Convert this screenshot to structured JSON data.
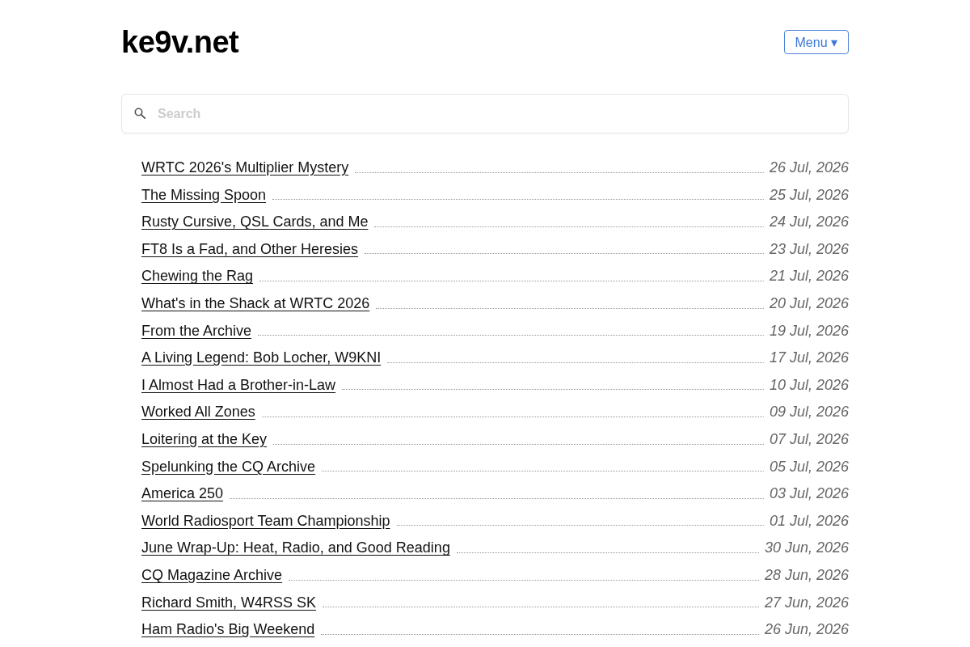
{
  "site": {
    "title": "ke9v.net"
  },
  "menu_button": {
    "label": "Menu ▾"
  },
  "search": {
    "placeholder": "Search"
  },
  "posts": [
    {
      "title": "WRTC 2026's Multiplier Mystery",
      "date": "26 Jul, 2026"
    },
    {
      "title": "The Missing Spoon",
      "date": "25 Jul, 2026"
    },
    {
      "title": "Rusty Cursive, QSL Cards, and Me",
      "date": "24 Jul, 2026"
    },
    {
      "title": "FT8 Is a Fad, and Other Heresies",
      "date": "23 Jul, 2026"
    },
    {
      "title": "Chewing the Rag",
      "date": "21 Jul, 2026"
    },
    {
      "title": "What's in the Shack at WRTC 2026",
      "date": "20 Jul, 2026"
    },
    {
      "title": "From the Archive",
      "date": "19 Jul, 2026"
    },
    {
      "title": "A Living Legend: Bob Locher, W9KNI",
      "date": "17 Jul, 2026"
    },
    {
      "title": "I Almost Had a Brother-in-Law",
      "date": "10 Jul, 2026"
    },
    {
      "title": "Worked All Zones",
      "date": "09 Jul, 2026"
    },
    {
      "title": "Loitering at the Key",
      "date": "07 Jul, 2026"
    },
    {
      "title": "Spelunking the CQ Archive",
      "date": "05 Jul, 2026"
    },
    {
      "title": "America 250",
      "date": "03 Jul, 2026"
    },
    {
      "title": "World Radiosport Team Championship",
      "date": "01 Jul, 2026"
    },
    {
      "title": "June Wrap-Up: Heat, Radio, and Good Reading",
      "date": "30 Jun, 2026"
    },
    {
      "title": "CQ Magazine Archive",
      "date": "28 Jun, 2026"
    },
    {
      "title": "Richard Smith, W4RSS SK",
      "date": "27 Jun, 2026"
    },
    {
      "title": "Ham Radio's Big Weekend",
      "date": "26 Jun, 2026"
    }
  ]
}
